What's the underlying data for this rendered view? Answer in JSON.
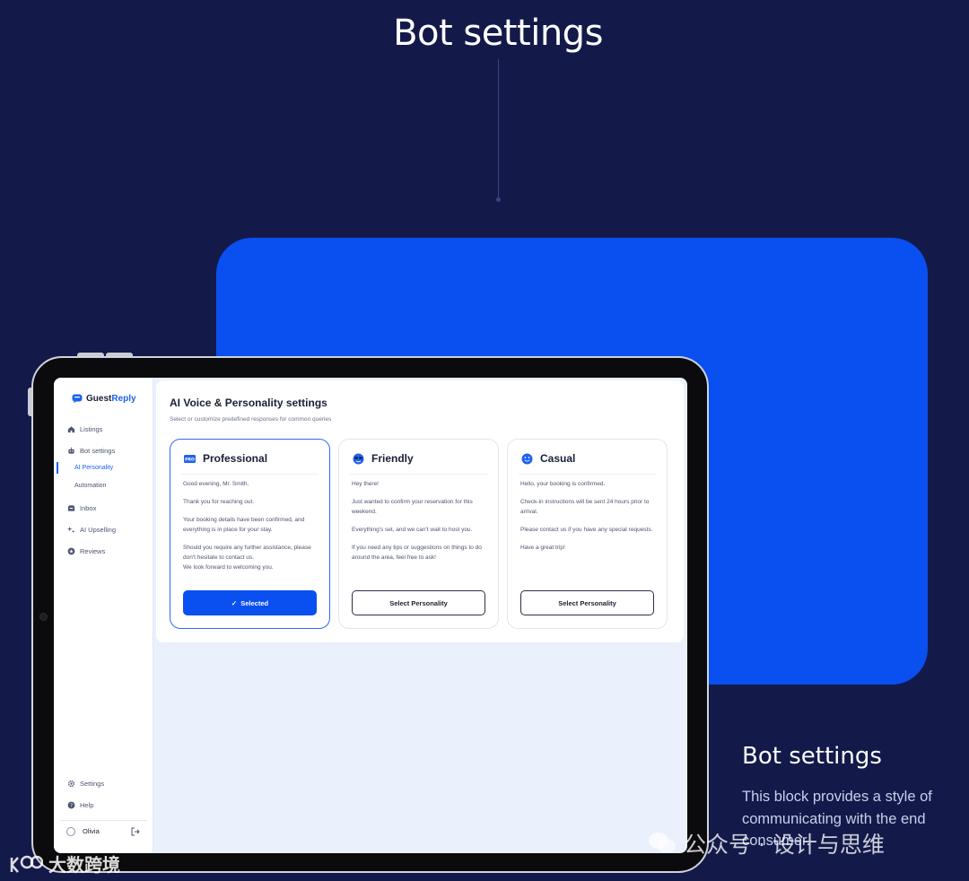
{
  "hero": {
    "title": "Bot settings"
  },
  "caption": {
    "title": "Bot settings",
    "text": "This block provides a style of communicating with the end consumer."
  },
  "watermarks": {
    "right": "公众号 · 设计与思维",
    "left": "大数跨境"
  },
  "app": {
    "logo": {
      "part1": "Guest",
      "part2": "Reply"
    },
    "nav": {
      "listings": "Listings",
      "bot_settings": "Bot settings",
      "ai_personality": "AI Personality",
      "automation": "Automation",
      "inbox": "Inbox",
      "ai_upselling": "AI Upselling",
      "reviews": "Reviews",
      "settings": "Settings",
      "help": "Help"
    },
    "user": {
      "name": "Olivia"
    },
    "page": {
      "title": "AI Voice & Personality settings",
      "subtitle": "Select or customize predefined responses for common queries"
    },
    "personalities": [
      {
        "name": "Professional",
        "badge": "PRO",
        "lines": [
          "Good evening, Mr. Smith.",
          "Thank you for reaching out.",
          "Your booking details have been confirmed, and everything is in place for your stay.",
          "Should you require any further assistance, please don't hesitate to contact us.",
          "We look forward to welcoming you."
        ],
        "button": "Selected"
      },
      {
        "name": "Friendly",
        "lines": [
          "Hey there!",
          "Just wanted to confirm your reservation for this weekend.",
          "Everything's set, and we can't wait to host you.",
          "If you need any tips or suggestions on things to do around the area, feel free to ask!"
        ],
        "button": "Select Personality"
      },
      {
        "name": "Casual",
        "lines": [
          "Hello, your booking is confirmed.",
          "Check-in instructions will be sent 24 hours prior to arrival.",
          "Please contact us if you have any special requests.",
          "Have a great trip!"
        ],
        "button": "Select Personality"
      }
    ]
  },
  "colors": {
    "background": "#131a4a",
    "accent_blue": "#0a4ff0",
    "screen_bg": "#eaf0fc"
  }
}
